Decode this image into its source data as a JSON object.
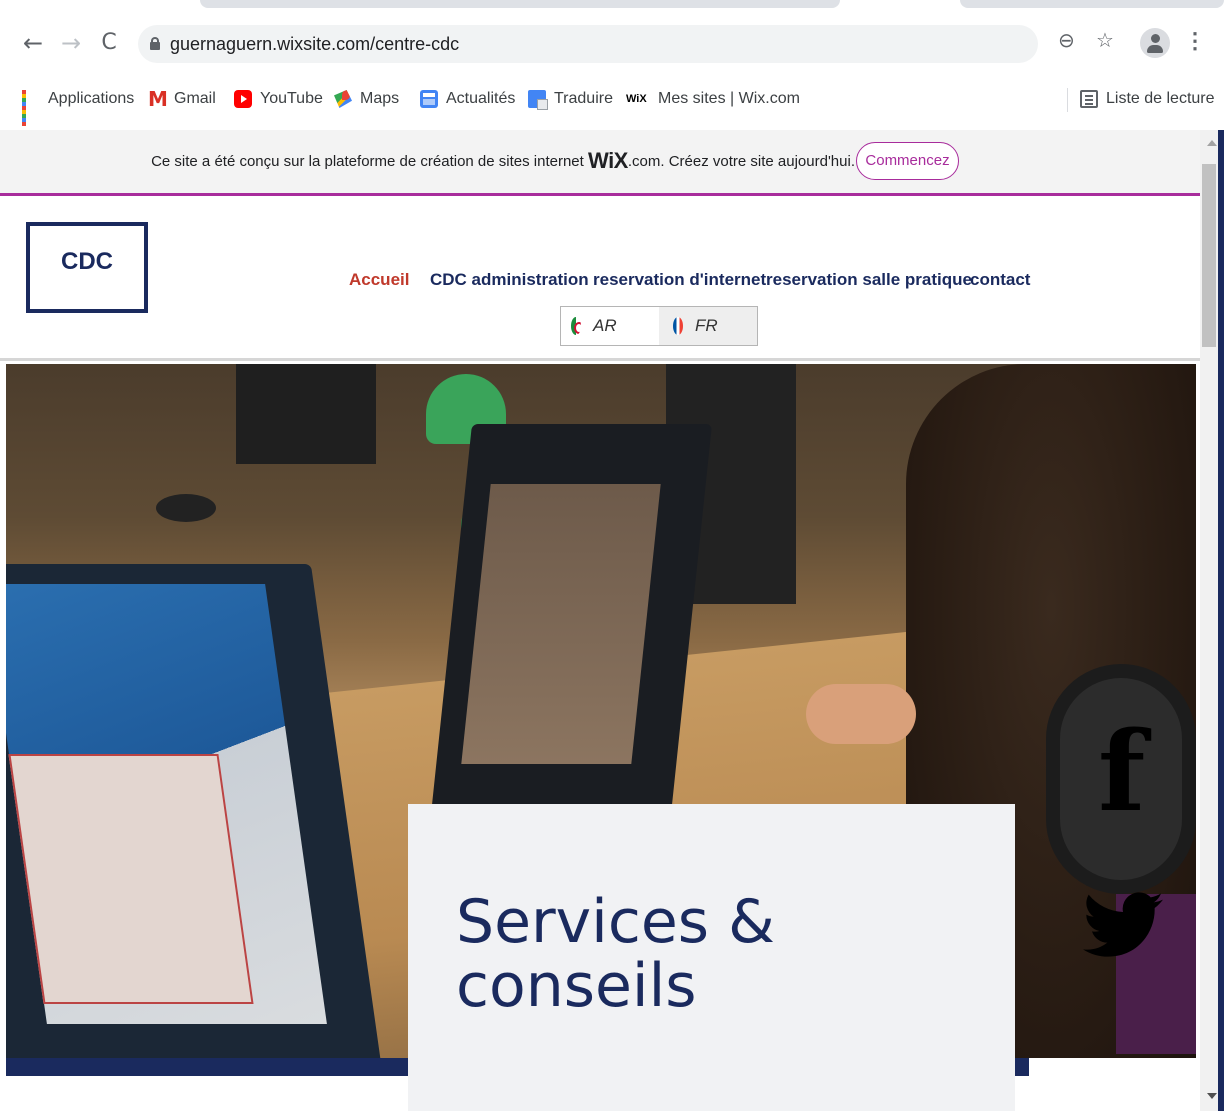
{
  "browser": {
    "url": "guernaguern.wixsite.com/centre-cdc",
    "nav": {
      "back": "←",
      "forward": "→",
      "reload": "C"
    },
    "bookmarks": [
      {
        "label": "Applications",
        "icon": "apps-grid-icon"
      },
      {
        "label": "Gmail",
        "icon": "gmail-icon"
      },
      {
        "label": "YouTube",
        "icon": "youtube-icon"
      },
      {
        "label": "Maps",
        "icon": "maps-icon"
      },
      {
        "label": "Actualités",
        "icon": "news-icon"
      },
      {
        "label": "Traduire",
        "icon": "translate-icon"
      },
      {
        "label": "Mes sites | Wix.com",
        "icon": "wix-icon"
      }
    ],
    "reading_list": "Liste de lecture"
  },
  "wix_banner": {
    "text_before": "Ce site a été conçu sur la plateforme de création de sites internet",
    "brand": "WiX",
    "text_after": ".com. Créez votre site aujourd'hui.",
    "button": "Commencez",
    "accent": "#a82c9c"
  },
  "site": {
    "logo": "CDC",
    "nav": [
      {
        "label": "Accueil",
        "active": true
      },
      {
        "label": "CDC administration"
      },
      {
        "label": "reservation d'internet"
      },
      {
        "label": "reservation salle pratique"
      },
      {
        "label": "contact"
      }
    ],
    "languages": [
      {
        "code": "AR",
        "flag": "algeria-flag-icon"
      },
      {
        "code": "FR",
        "flag": "france-flag-icon",
        "selected": true
      }
    ],
    "colors": {
      "navy": "#1a2a5e",
      "active": "#c0392b"
    }
  },
  "hero": {
    "title_line1": "Services &",
    "title_line2": "conseils",
    "social": [
      "facebook-icon",
      "twitter-icon"
    ]
  }
}
